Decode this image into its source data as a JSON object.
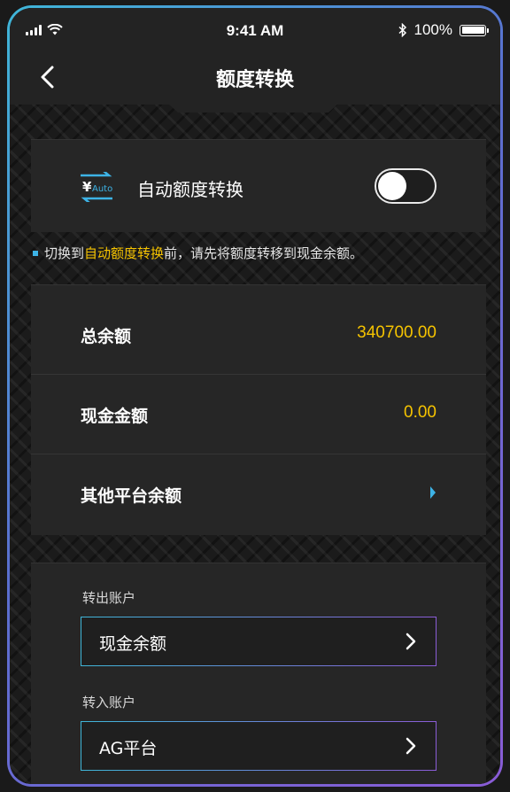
{
  "status_bar": {
    "time": "9:41 AM",
    "battery": "100%"
  },
  "nav": {
    "title": "额度转换"
  },
  "auto_transfer": {
    "icon_text": "¥Auto",
    "label": "自动额度转换",
    "toggle_on": false
  },
  "tip": {
    "prefix": "切换到",
    "highlight": "自动额度转换",
    "suffix": "前，请先将额度转移到现金余额。"
  },
  "balances": [
    {
      "name": "总余额",
      "value": "340700.00"
    },
    {
      "name": "现金金额",
      "value": "0.00"
    },
    {
      "name": "其他平台余额",
      "value": ""
    }
  ],
  "transfer": {
    "from_label": "转出账户",
    "from_value": "现金余额",
    "to_label": "转入账户",
    "to_value": "AG平台"
  },
  "colors": {
    "accent_yellow": "#f5c300",
    "accent_blue": "#3db3e6",
    "border_gradient_start": "#3fb6d8",
    "border_gradient_end": "#8a5cd6"
  }
}
